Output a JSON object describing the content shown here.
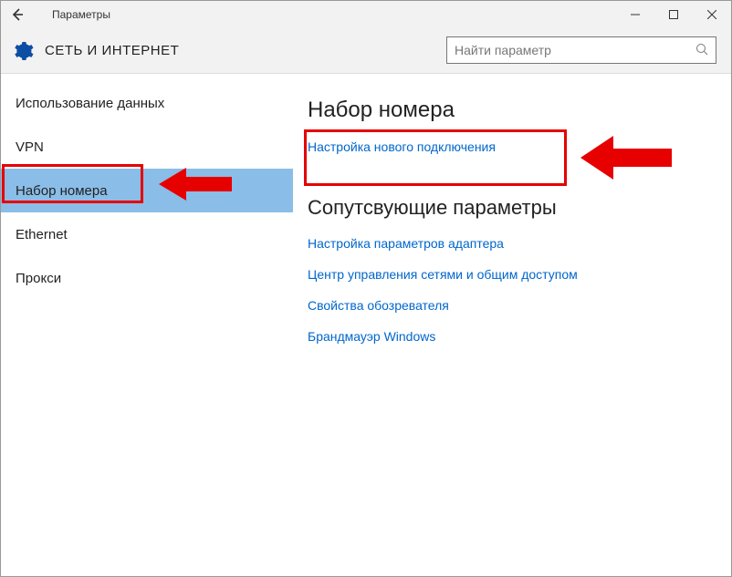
{
  "titlebar": {
    "title": "Параметры"
  },
  "header": {
    "title": "СЕТЬ И ИНТЕРНЕТ"
  },
  "search": {
    "placeholder": "Найти параметр"
  },
  "sidebar": {
    "items": [
      {
        "label": "Использование данных"
      },
      {
        "label": "VPN"
      },
      {
        "label": "Набор номера"
      },
      {
        "label": "Ethernet"
      },
      {
        "label": "Прокси"
      }
    ],
    "selected_index": 2
  },
  "content": {
    "heading": "Набор номера",
    "primary_link": "Настройка нового подключения",
    "related_heading": "Сопутсвующие параметры",
    "related_links": [
      "Настройка параметров адаптера",
      "Центр управления сетями и общим доступом",
      "Свойства обозревателя",
      "Брандмауэр Windows"
    ]
  },
  "colors": {
    "accent": "#0066cc",
    "highlight": "#e60000",
    "gear": "#0c4ea3"
  }
}
